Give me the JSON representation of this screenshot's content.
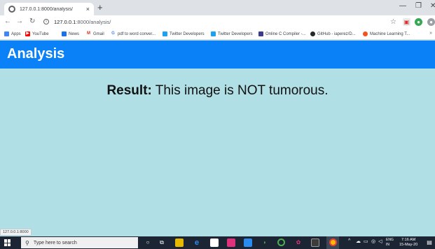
{
  "browser": {
    "tab_title": "127.0.0.1:8000/analysis/",
    "tab_close": "×",
    "new_tab": "+",
    "url_host": "127.0.0.1",
    "url_rest": ":8000/analysis/",
    "status_url": "127.0.0.1:8000",
    "bookmarks": [
      {
        "label": "Apps",
        "icon": "apps-grid-icon",
        "color": "#4285f4"
      },
      {
        "label": "YouTube",
        "icon": "youtube-icon",
        "color": "#ff0000"
      },
      {
        "label": "News",
        "icon": "news-icon",
        "color": "#1a73e8"
      },
      {
        "label": "Gmail",
        "icon": "gmail-icon",
        "color": "#d93025"
      },
      {
        "label": "pdf to word conver...",
        "icon": "google-icon",
        "color": "#4285f4"
      },
      {
        "label": "Twitter Developers",
        "icon": "twitter-icon",
        "color": "#1da1f2"
      },
      {
        "label": "Twitter Developers",
        "icon": "twitter-icon",
        "color": "#1da1f2"
      },
      {
        "label": "Online C Compiler -...",
        "icon": "compiler-icon",
        "color": "#3c3c8c"
      },
      {
        "label": "GitHub - iaperez/D...",
        "icon": "github-icon",
        "color": "#24292e"
      },
      {
        "label": "Machine Learning T...",
        "icon": "ml-icon",
        "color": "#f4511e"
      }
    ]
  },
  "page": {
    "header_title": "Analysis",
    "header_color": "#0b81f7",
    "background_color": "#b0dfe6",
    "result_label": "Result:",
    "result_text": " This image is NOT tumorous."
  },
  "taskbar": {
    "search_placeholder": "Type here to search",
    "lang_line1": "ENG",
    "lang_line2": "IN",
    "time": "7:16 AM",
    "date": "15-May-20"
  }
}
